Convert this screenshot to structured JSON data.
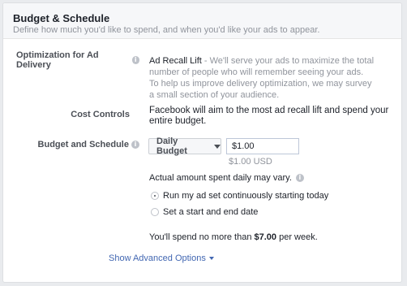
{
  "header": {
    "title": "Budget & Schedule",
    "subtitle": "Define how much you'd like to spend, and when you'd like your ads to appear."
  },
  "optimization": {
    "label": "Optimization for Ad Delivery",
    "value_bold": "Ad Recall Lift",
    "value_desc_line1": " - We'll serve your ads to maximize the total",
    "value_desc_line2": "number of people who will remember seeing your ads.",
    "note_line1": "To help us improve delivery optimization, we may survey",
    "note_line2": "a small section of your audience."
  },
  "cost_controls": {
    "label": "Cost Controls",
    "text_line1": "Facebook will aim to the most ad recall lift and spend your",
    "text_line2": "entire budget."
  },
  "budget": {
    "label": "Budget and Schedule",
    "type_selected": "Daily Budget",
    "amount_value": "$1.00",
    "amount_usd": "$1.00 USD",
    "variance_note": "Actual amount spent daily may vary.",
    "schedule_options": [
      {
        "label": "Run my ad set continuously starting today",
        "selected": true
      },
      {
        "label": "Set a start and end date",
        "selected": false
      }
    ],
    "weekly_prefix": "You'll spend no more than ",
    "weekly_amount": "$7.00",
    "weekly_suffix": " per week."
  },
  "advanced_link": "Show Advanced Options",
  "colors": {
    "link": "#4267b2",
    "muted": "#90949c",
    "label": "#4b4f56",
    "border": "#dddfe2"
  },
  "icons": {
    "info": "info-icon",
    "dropdown": "caret-down-icon"
  }
}
